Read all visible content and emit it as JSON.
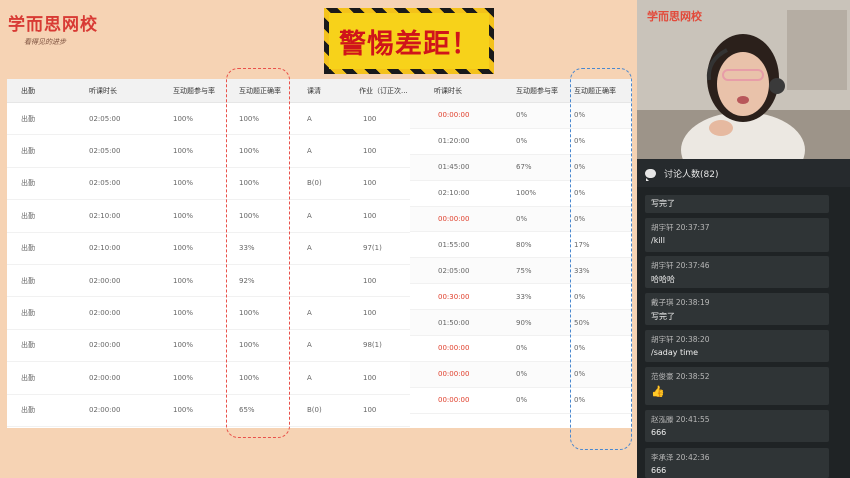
{
  "logo": {
    "name": "学而思网校",
    "slogan": "看得见的进步"
  },
  "banner": {
    "text": "警惕差距！"
  },
  "table_left": {
    "headers": [
      "出勤",
      "听课时长",
      "互动题参与率",
      "互动题正确率",
      "课清",
      "作业（订正次..."
    ],
    "rows": [
      [
        "出勤",
        "02:05:00",
        "100%",
        "100%",
        "A",
        "100"
      ],
      [
        "出勤",
        "02:05:00",
        "100%",
        "100%",
        "A",
        "100"
      ],
      [
        "出勤",
        "02:05:00",
        "100%",
        "100%",
        "B(0)",
        "100"
      ],
      [
        "出勤",
        "02:10:00",
        "100%",
        "100%",
        "A",
        "100"
      ],
      [
        "出勤",
        "02:10:00",
        "100%",
        "33%",
        "A",
        "97(1)"
      ],
      [
        "出勤",
        "02:00:00",
        "100%",
        "92%",
        "",
        "100"
      ],
      [
        "出勤",
        "02:00:00",
        "100%",
        "100%",
        "A",
        "100"
      ],
      [
        "出勤",
        "02:00:00",
        "100%",
        "100%",
        "A",
        "98(1)"
      ],
      [
        "出勤",
        "02:00:00",
        "100%",
        "100%",
        "A",
        "100"
      ],
      [
        "出勤",
        "02:00:00",
        "100%",
        "65%",
        "B(0)",
        "100"
      ]
    ]
  },
  "table_right": {
    "headers": [
      "听课时长",
      "互动题参与率",
      "互动题正确率"
    ],
    "rows": [
      [
        "00:00:00",
        "0%",
        "0%"
      ],
      [
        "01:20:00",
        "0%",
        "0%"
      ],
      [
        "01:45:00",
        "67%",
        "0%"
      ],
      [
        "02:10:00",
        "100%",
        "0%"
      ],
      [
        "00:00:00",
        "0%",
        "0%"
      ],
      [
        "01:55:00",
        "80%",
        "17%"
      ],
      [
        "02:05:00",
        "75%",
        "33%"
      ],
      [
        "00:30:00",
        "33%",
        "0%"
      ],
      [
        "01:50:00",
        "90%",
        "50%"
      ],
      [
        "00:00:00",
        "0%",
        "0%"
      ],
      [
        "00:00:00",
        "0%",
        "0%"
      ],
      [
        "00:00:00",
        "0%",
        "0%"
      ]
    ],
    "red_rows": [
      0,
      4,
      7,
      9,
      10,
      11
    ]
  },
  "video": {
    "logo": "学而思网校"
  },
  "chat": {
    "title": "讨论人数(82)",
    "messages": [
      {
        "meta": "",
        "text": "写完了"
      },
      {
        "meta": "胡宇轩  20:37:37",
        "text": "/kill"
      },
      {
        "meta": "胡宇轩  20:37:46",
        "text": "哈哈哈"
      },
      {
        "meta": "戴子琪  20:38:19",
        "text": "写完了"
      },
      {
        "meta": "胡宇轩  20:38:20",
        "text": "/saday time"
      },
      {
        "meta": "范俊豪  20:38:52",
        "text": "👍"
      },
      {
        "meta": "赵泓滕  20:41:55",
        "text": "666"
      },
      {
        "meta": "李承泽  20:42:36",
        "text": "666"
      }
    ]
  },
  "colors": {
    "accent_red": "#e0402d",
    "dash_red": "#e9514a",
    "dash_blue": "#4a88cf",
    "banner_yellow": "#f7d21a"
  }
}
